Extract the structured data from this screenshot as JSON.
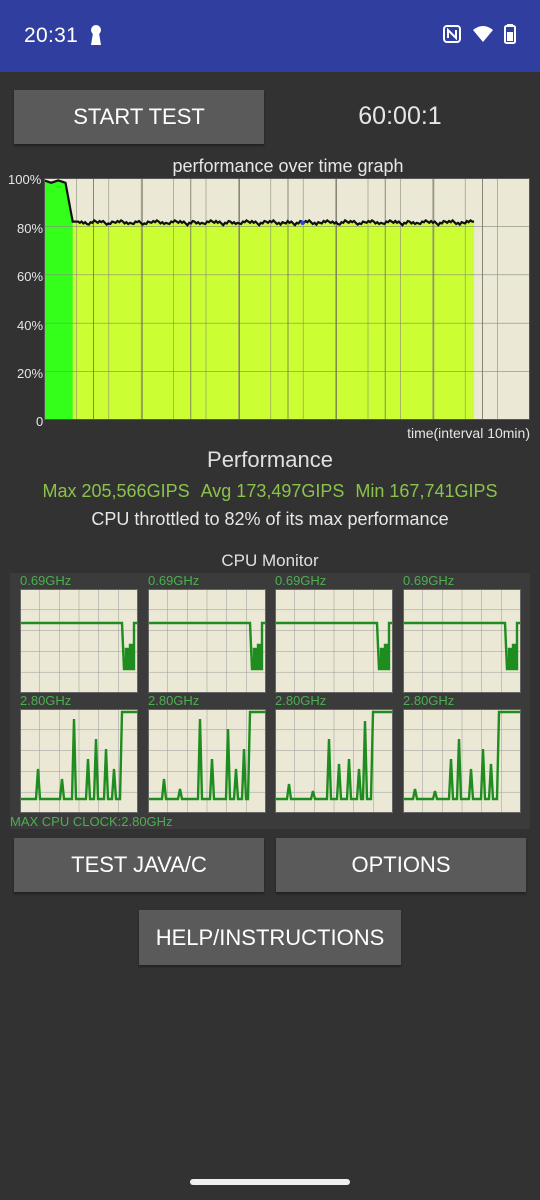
{
  "status": {
    "time": "20:31"
  },
  "toolbar": {
    "start_label": "START TEST",
    "timer": "60:00:1"
  },
  "graph": {
    "title": "performance over time graph",
    "y_labels": [
      "100%",
      "80%",
      "60%",
      "40%",
      "20%",
      "0"
    ],
    "x_caption": "time(interval 10min)"
  },
  "performance": {
    "heading": "Performance",
    "max": "Max 205,566GIPS",
    "avg": "Avg 173,497GIPS",
    "min": "Min 167,741GIPS",
    "throttle": "CPU throttled to 82% of its max performance"
  },
  "cpu_monitor": {
    "heading": "CPU Monitor",
    "freq_top": [
      "0.69GHz",
      "0.69GHz",
      "0.69GHz",
      "0.69GHz"
    ],
    "freq_bottom": [
      "2.80GHz",
      "2.80GHz",
      "2.80GHz",
      "2.80GHz"
    ],
    "max_clock": "MAX CPU CLOCK:2.80GHz"
  },
  "buttons": {
    "test_java": "TEST JAVA/C",
    "options": "OPTIONS",
    "help": "HELP/INSTRUCTIONS"
  },
  "colors": {
    "status_bar": "#303f9f",
    "fill_green": "#33ff1a",
    "fill_lime": "#ccff33",
    "cpu_green": "#1e8c1e"
  },
  "chart_data": {
    "type": "area",
    "title": "performance over time graph",
    "xlabel": "time(interval 10min)",
    "ylabel": "",
    "x": [
      0,
      1,
      2,
      3,
      4,
      5,
      6,
      7,
      8,
      9,
      10,
      11,
      12,
      13,
      14,
      15,
      16,
      17,
      18,
      19,
      20,
      21,
      22,
      23,
      24,
      25,
      26,
      27,
      28,
      29,
      30,
      31,
      32,
      33,
      34,
      35,
      36,
      37,
      38,
      39,
      40,
      41,
      42,
      43,
      44,
      45,
      46,
      47,
      48,
      49,
      50,
      51,
      52,
      53,
      54,
      55,
      56,
      57,
      58,
      59,
      60
    ],
    "values": [
      99,
      98,
      99,
      98,
      82,
      82,
      81,
      82,
      82,
      81,
      82,
      82,
      81,
      82,
      81,
      82,
      82,
      81,
      82,
      82,
      81,
      82,
      81,
      82,
      82,
      81,
      82,
      81,
      82,
      82,
      81,
      82,
      82,
      81,
      82,
      81,
      82,
      82,
      81,
      82,
      82,
      81,
      82,
      82,
      81,
      82,
      82,
      81,
      82,
      82,
      81,
      82,
      81,
      82,
      82,
      81,
      82,
      82,
      81,
      82,
      82
    ],
    "xlim": [
      0,
      60
    ],
    "ylim": [
      0,
      100
    ],
    "grid": true
  }
}
